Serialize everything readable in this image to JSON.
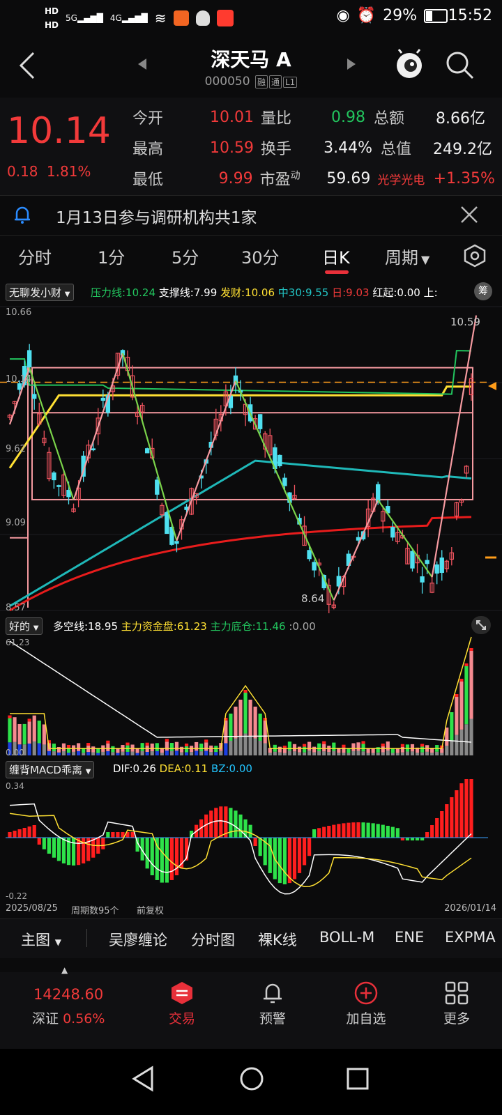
{
  "status_bar": {
    "time": "15:52",
    "battery": "29%",
    "hd1": "HD",
    "hd2": "HD",
    "net1": "5G",
    "net2": "4G"
  },
  "header": {
    "title": "深天马 A",
    "code": "000050",
    "badges": [
      "融",
      "通",
      "L1"
    ]
  },
  "quote": {
    "price": "10.14",
    "change": "0.18",
    "change_pct": "1.81%",
    "rows": [
      [
        {
          "label": "今开",
          "value": "10.01",
          "cls": "red"
        },
        {
          "label": "量比",
          "value": "0.98",
          "cls": "green"
        },
        {
          "label": "总额",
          "value": "8.66亿",
          "cls": "white"
        }
      ],
      [
        {
          "label": "最高",
          "value": "10.59",
          "cls": "red"
        },
        {
          "label": "换手",
          "value": "3.44%",
          "cls": "white"
        },
        {
          "label": "总值",
          "value": "249.2亿",
          "cls": "white"
        }
      ],
      [
        {
          "label": "最低",
          "value": "9.99",
          "cls": "red"
        },
        {
          "label": "市盈",
          "sup": "动",
          "value": "59.69",
          "cls": "white"
        },
        {
          "label": "光学光电",
          "value": "+1.35%",
          "cls": "red"
        }
      ]
    ]
  },
  "notice": {
    "text": "1月13日参与调研机构共1家"
  },
  "tabs": [
    "分时",
    "1分",
    "5分",
    "30分",
    "日K",
    "周期"
  ],
  "active_tab": "日K",
  "main_indicator": {
    "name": "无聊发小财",
    "items": [
      {
        "text": "压力线:10.24",
        "color": "#22c55e"
      },
      {
        "text": "支撑线:7.99",
        "color": "#ffffff"
      },
      {
        "text": "发财:10.06",
        "color": "#ffe033"
      },
      {
        "text": "中30:9.55",
        "color": "#22c5c5"
      },
      {
        "text": "日:9.03",
        "color": "#f23a3a"
      },
      {
        "text": "红起:0.00",
        "color": "#ffffff"
      },
      {
        "text": "上:",
        "color": "#ffffff"
      }
    ],
    "cal_label": "筹"
  },
  "price_axis": [
    "10.66",
    "10.14",
    "9.62",
    "9.09",
    "8.57"
  ],
  "price_marks": {
    "high": "10.59",
    "low": "8.64"
  },
  "sub1": {
    "name": "好的",
    "items": [
      {
        "text": "多空线:18.95",
        "color": "#ffffff"
      },
      {
        "text": "主力资金盘:61.23",
        "color": "#ffe033"
      },
      {
        "text": "主力底仓:11.46",
        "color": "#22c55e"
      },
      {
        "text": ":0.00",
        "color": "#aaaaaa"
      }
    ],
    "axis": [
      "61.23",
      "0.00"
    ]
  },
  "sub2": {
    "name": "缠背MACD乖离",
    "items": [
      {
        "text": "DIF:0.26",
        "color": "#ffffff"
      },
      {
        "text": "DEA:0.11",
        "color": "#ffe033"
      },
      {
        "text": "BZ:0.00",
        "color": "#22c5ff"
      }
    ],
    "axis": [
      "0.34",
      "-0.22"
    ]
  },
  "date_bar": {
    "start": "2025/08/25",
    "count": "周期数95个",
    "adjust": "前复权",
    "end": "2026/01/14"
  },
  "chart_menu": [
    "主图",
    "吴廖缠论",
    "分时图",
    "裸K线",
    "BOLL-M",
    "ENE",
    "EXPMA"
  ],
  "bottom_nav": {
    "index_value": "14248.60",
    "index_name": "深证",
    "index_pct": "0.56%",
    "items": [
      {
        "label": "交易"
      },
      {
        "label": "预警"
      },
      {
        "label": "加自选"
      },
      {
        "label": "更多"
      }
    ]
  }
}
